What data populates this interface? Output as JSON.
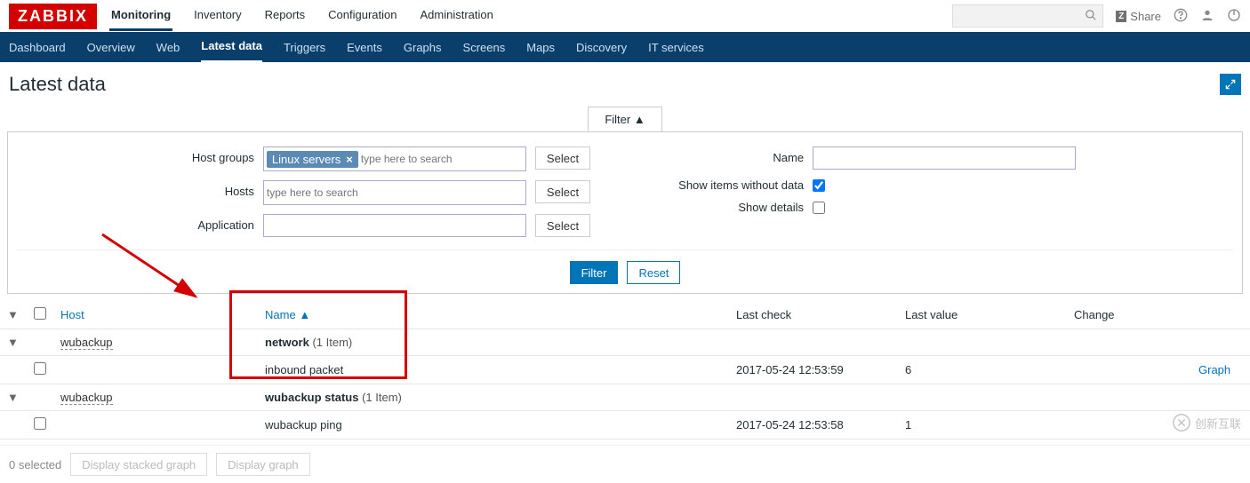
{
  "brand": "ZABBIX",
  "topnav": [
    "Monitoring",
    "Inventory",
    "Reports",
    "Configuration",
    "Administration"
  ],
  "topnav_active": 0,
  "share_label": "Share",
  "subnav": [
    "Dashboard",
    "Overview",
    "Web",
    "Latest data",
    "Triggers",
    "Events",
    "Graphs",
    "Screens",
    "Maps",
    "Discovery",
    "IT services"
  ],
  "subnav_active": 3,
  "page_title": "Latest data",
  "filter": {
    "tab_label": "Filter ▲",
    "host_groups_label": "Host groups",
    "host_groups_tag": "Linux servers",
    "ms_placeholder": "type here to search",
    "hosts_label": "Hosts",
    "application_label": "Application",
    "name_label": "Name",
    "show_without_data_label": "Show items without data",
    "show_without_data_checked": true,
    "show_details_label": "Show details",
    "show_details_checked": false,
    "select_btn": "Select",
    "filter_btn": "Filter",
    "reset_btn": "Reset"
  },
  "table": {
    "headers": {
      "host": "Host",
      "name": "Name",
      "last_check": "Last check",
      "last_value": "Last value",
      "change": "Change"
    },
    "rows": [
      {
        "type": "group",
        "host": "wubackup",
        "name_bold": "network",
        "count": "(1 Item)"
      },
      {
        "type": "item",
        "name": "inbound packet",
        "last_check": "2017-05-24 12:53:59",
        "last_value": "6",
        "change": "",
        "link": "Graph"
      },
      {
        "type": "group",
        "host": "wubackup",
        "name_bold": "wubackup status",
        "count": "(1 Item)"
      },
      {
        "type": "item",
        "name": "wubackup ping",
        "last_check": "2017-05-24 12:53:58",
        "last_value": "1",
        "change": "",
        "link": ""
      }
    ]
  },
  "footer": {
    "selected": "0 selected",
    "btn1": "Display stacked graph",
    "btn2": "Display graph"
  },
  "watermark": "创新互联"
}
